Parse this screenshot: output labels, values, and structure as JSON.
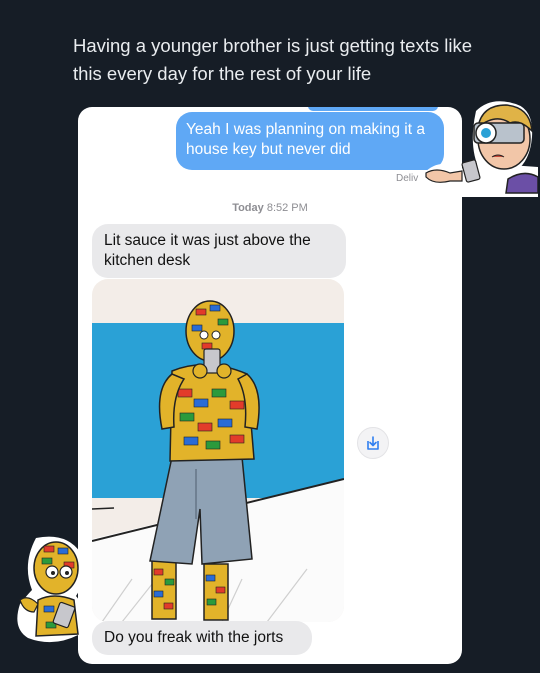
{
  "caption": {
    "text": "Having a younger brother is just getting texts like this every day for the rest of your life"
  },
  "messages": {
    "sent": "Yeah I was planning on making it a house key but never did",
    "delivered": "Deliv",
    "timestamp_day": "Today",
    "timestamp_time": "8:52 PM",
    "received_1": "Lit sauce it was just above the kitchen desk",
    "received_2": "Do you freak with the jorts"
  },
  "icons": {
    "save": "download-icon",
    "sticker_right": "glasses-guy-sticker",
    "sticker_left": "lego-guy-sticker"
  },
  "colors": {
    "background": "#161d26",
    "sent_bubble": "#5fa8f5",
    "received_bubble": "#e9e9eb"
  }
}
